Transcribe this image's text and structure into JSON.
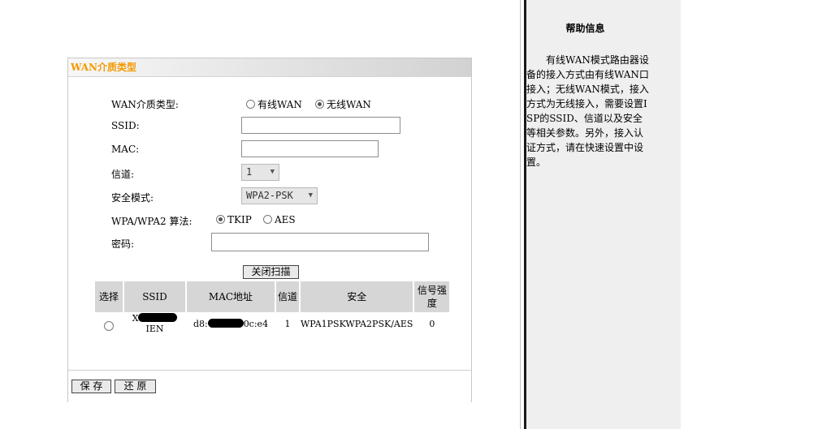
{
  "panel": {
    "title": "WAN介质类型",
    "wan_type_label": "WAN介质类型:",
    "wan_options": [
      {
        "label": "有线WAN",
        "checked": false
      },
      {
        "label": "无线WAN",
        "checked": true
      }
    ],
    "ssid_label": "SSID:",
    "ssid_value": "",
    "mac_label": "MAC:",
    "mac_value": "",
    "channel_label": "信道:",
    "channel_value": "1",
    "security_label": "安全模式:",
    "security_value": "WPA2-PSK",
    "algo_label": "WPA/WPA2 算法:",
    "algo_options": [
      {
        "label": "TKIP",
        "checked": true
      },
      {
        "label": "AES",
        "checked": false
      }
    ],
    "password_label": "密码:",
    "password_value": "",
    "scan_button": "关闭扫描",
    "table": {
      "headers": [
        "选择",
        "SSID",
        "MAC地址",
        "信道",
        "安全",
        "信号强度"
      ],
      "rows": [
        {
          "ssid_prefix": "X",
          "ssid_suffix": "IEN",
          "mac_prefix": "d8:",
          "mac_suffix": "0c:e4",
          "channel": "1",
          "security": "WPA1PSKWPA2PSK/AES",
          "signal": "0"
        }
      ]
    },
    "save_button": "保 存",
    "restore_button": "还 原"
  },
  "help": {
    "title": "帮助信息",
    "text": "有线WAN模式路由器设备的接入方式由有线WAN口接入；无线WAN模式，接入方式为无线接入，需要设置ISP的SSID、信道以及安全等相关参数。另外，接入认证方式，请在快速设置中设置。"
  }
}
